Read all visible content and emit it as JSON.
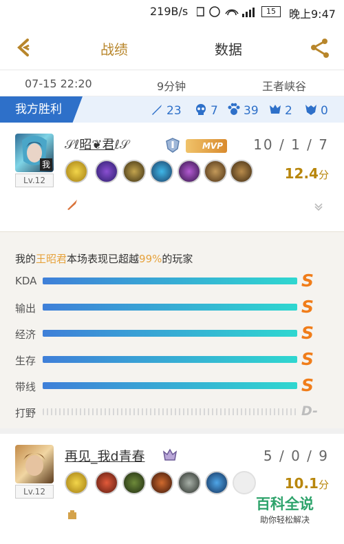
{
  "status": {
    "speed": "219B/s",
    "battery": "15",
    "time": "晚上9:47"
  },
  "nav": {
    "tab_record": "战绩",
    "tab_data": "数据"
  },
  "info": {
    "datetime": "07-15 22:20",
    "duration": "9分钟",
    "map": "王者峡谷"
  },
  "team": {
    "result": "我方胜利",
    "kills": "23",
    "deaths": "7",
    "minion": "39",
    "tower": "2",
    "dragon": "0"
  },
  "player1": {
    "avatar_badge": "我",
    "level": "Lv.12",
    "name": "昭❦君",
    "mvp": "MVP",
    "kda": "10 / 1 / 7",
    "score": "12.4",
    "score_unit": "分"
  },
  "panel": {
    "pre": "我的",
    "hero": "王昭君",
    "mid": "本场表现已超越",
    "pct": "99%",
    "post": "的玩家",
    "rows": [
      {
        "label": "KDA",
        "grade": "S",
        "ratio": 1.0
      },
      {
        "label": "输出",
        "grade": "S",
        "ratio": 1.0
      },
      {
        "label": "经济",
        "grade": "S",
        "ratio": 1.0
      },
      {
        "label": "生存",
        "grade": "S",
        "ratio": 1.0
      },
      {
        "label": "带线",
        "grade": "S",
        "ratio": 1.0
      },
      {
        "label": "打野",
        "grade": "D-",
        "ratio": 0.0
      }
    ]
  },
  "player2": {
    "level": "Lv.12",
    "name": "再见_我d青春",
    "kda": "5 / 0 / 9",
    "score": "10.1",
    "score_unit": "分"
  },
  "watermark": {
    "title": "百科全说",
    "sub": "助你轻松解决"
  },
  "colors": {
    "accent": "#b8862b",
    "team_blue": "#2e70c9",
    "grade_orange": "#f07d1a"
  }
}
